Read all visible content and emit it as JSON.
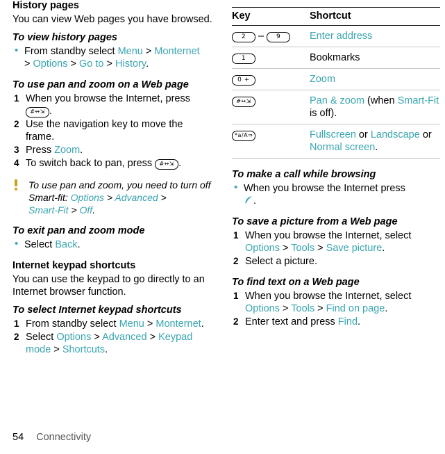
{
  "left": {
    "history": {
      "heading": "History pages",
      "body": "You can view Web pages you have browsed.",
      "sub": "To view history pages",
      "bullet_pre": "From standby select ",
      "menu": "Menu",
      "montenet": "Monternet",
      "options": "Options",
      "goto": "Go to",
      "history": "History",
      "gt": ">",
      "period": "."
    },
    "panzoom": {
      "sub": "To use pan and zoom on a Web page",
      "step1_a": "When you browse the Internet, press",
      "step1_key": "#↔⇲",
      "step2": "Use the navigation key to move the frame.",
      "step3_a": "Press ",
      "step3_zoom": "Zoom",
      "step4_a": "To switch back to pan, press ",
      "step4_key": "#↔⇲"
    },
    "note": {
      "text_a": "To use pan and zoom, you need to turn off Smart-fit: ",
      "options": "Options",
      "advanced": "Advanced",
      "smartfit": "Smart-Fit",
      "off": "Off",
      "gt": ">"
    },
    "exit": {
      "sub": "To exit pan and zoom mode",
      "bullet_pre": "Select ",
      "back": "Back"
    },
    "keypad": {
      "heading": "Internet keypad shortcuts",
      "body": "You can use the keypad to go directly to an Internet browser function.",
      "sub": "To select Internet keypad shortcuts",
      "step1_pre": "From standby select ",
      "menu": "Menu",
      "montenet": "Monternet",
      "step2_pre": "Select ",
      "options": "Options",
      "advanced": "Advanced",
      "keypadmode": "Keypad mode",
      "shortcuts": "Shortcuts",
      "gt": ">"
    }
  },
  "right": {
    "table": {
      "header_key": "Key",
      "header_shortcut": "Shortcut",
      "rows": [
        {
          "key_type": "range",
          "key1": "2",
          "dash": "–",
          "key2": "9",
          "shortcut": "Enter address",
          "link": true
        },
        {
          "key_type": "single",
          "key1": "1",
          "shortcut": "Bookmarks",
          "link": false
        },
        {
          "key_type": "single",
          "key1": "0 +",
          "shortcut": "Zoom",
          "link": true
        },
        {
          "key_type": "single",
          "key1": "#↔⇲",
          "shortcut_parts": [
            "Pan & zoom",
            " (when ",
            "Smart-Fit",
            " is off)."
          ],
          "link": true
        },
        {
          "key_type": "single",
          "key1": "*a/A⇒",
          "shortcut_parts": [
            "Fullscreen",
            " or ",
            "Landscape",
            " or ",
            "Normal screen",
            "."
          ],
          "link": true
        }
      ]
    },
    "call": {
      "sub": "To make a call while browsing",
      "bullet": "When you browse the Internet press",
      "period": "."
    },
    "save": {
      "sub": "To save a picture from a Web page",
      "step1_pre": "When you browse the Internet, select ",
      "options": "Options",
      "tools": "Tools",
      "savepicture": "Save picture",
      "step2": "Select a picture.",
      "gt": ">"
    },
    "find": {
      "sub": "To find text on a Web page",
      "step1_pre": "When you browse the Internet, select ",
      "options": "Options",
      "tools": "Tools",
      "findonpage": "Find on page",
      "step2_pre": "Enter text and press ",
      "find": "Find",
      "gt": ">"
    }
  },
  "footer": {
    "page": "54",
    "section": "Connectivity"
  }
}
